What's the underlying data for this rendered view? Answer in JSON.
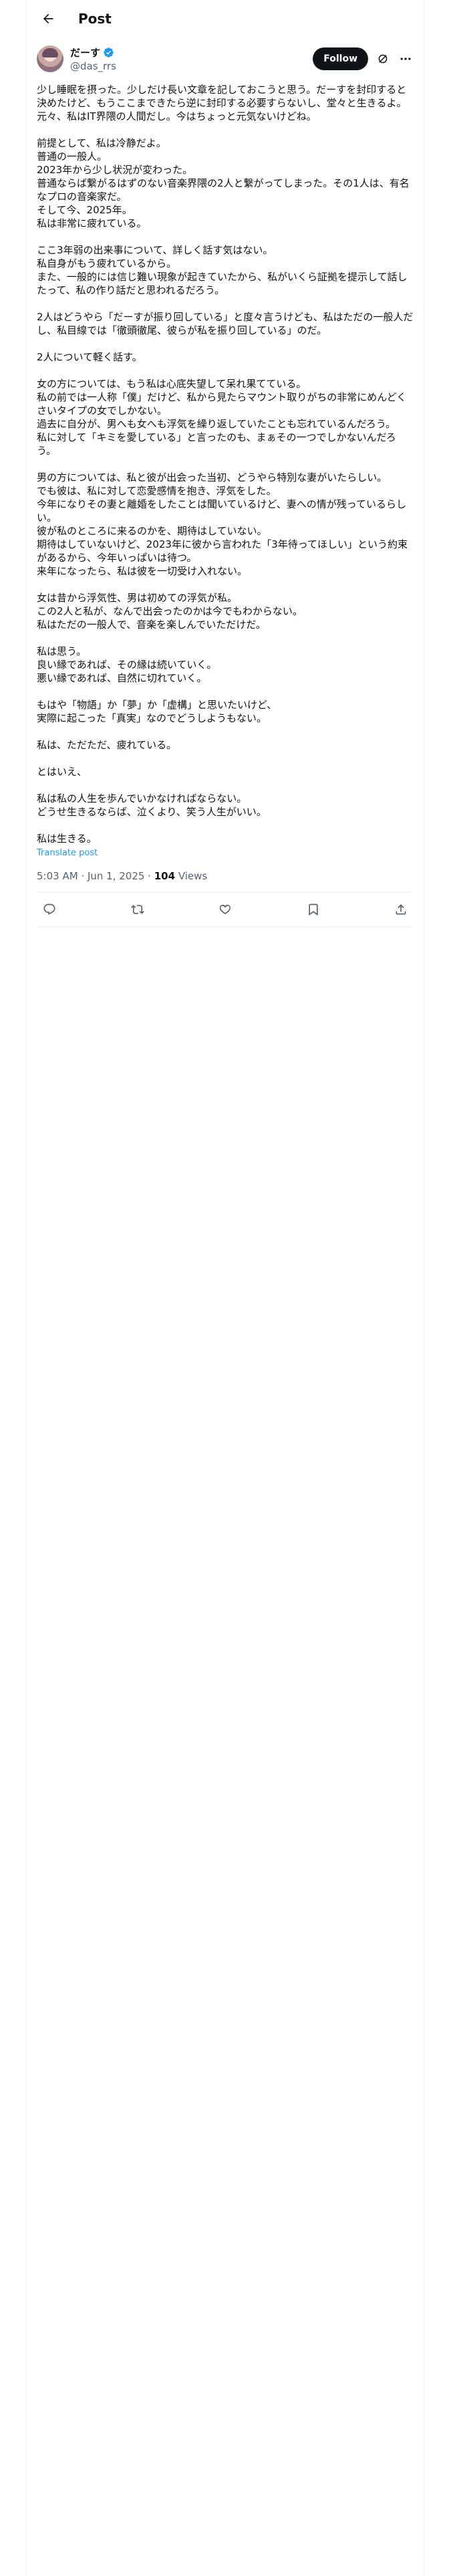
{
  "header": {
    "title": "Post",
    "back_icon": "arrow-left-icon"
  },
  "author": {
    "display_name": "だーす",
    "handle": "@das_rrs",
    "verified": true,
    "follow_label": "Follow",
    "accent": "#1d9bf0"
  },
  "post": {
    "text": "少し睡眠を摂った。少しだけ長い文章を記しておこうと思う。だーすを封印すると決めたけど、もうここまできたら逆に封印する必要すらないし、堂々と生きるよ。元々、私はIT界隈の人間だし。今はちょっと元気ないけどね。\n\n前提として、私は冷静だよ。\n普通の一般人。\n2023年から少し状況が変わった。\n普通ならば繋がるはずのない音楽界隈の2人と繋がってしまった。その1人は、有名なプロの音楽家だ。\nそして今、2025年。\n私は非常に疲れている。\n\nここ3年弱の出来事について、詳しく話す気はない。\n私自身がもう疲れているから。\nまた、一般的には信じ難い現象が起きていたから、私がいくら証拠を提示して話したって、私の作り話だと思われるだろう。\n\n2人はどうやら「だーすが振り回している」と度々言うけども、私はただの一般人だし、私目線では「徹頭徹尾、彼らが私を振り回している」のだ。\n\n2人について軽く話す。\n\n女の方については、もう私は心底失望して呆れ果てている。\n私の前では一人称「僕」だけど、私から見たらマウント取りがちの非常にめんどくさいタイプの女でしかない。\n過去に自分が、男へも女へも浮気を繰り返していたことも忘れているんだろう。\n私に対して「キミを愛している」と言ったのも、まぁその一つでしかないんだろう。\n\n男の方については、私と彼が出会った当初、どうやら特別な妻がいたらしい。\nでも彼は、私に対して恋愛感情を抱き、浮気をした。\n今年になりその妻と離婚をしたことは聞いているけど、妻への情が残っているらしい。\n彼が私のところに来るのかを、期待はしていない。\n期待はしていないけど、2023年に彼から言われた「3年待ってほしい」という約束があるから、今年いっぱいは待つ。\n来年になったら、私は彼を一切受け入れない。\n\n女は昔から浮気性、男は初めての浮気が私。\nこの2人と私が、なんで出会ったのかは今でもわからない。\n私はただの一般人で、音楽を楽しんでいただけだ。\n\n私は思う。\n良い縁であれば、その縁は続いていく。\n悪い縁であれば、自然に切れていく。\n\nもはや「物語」か「夢」か「虚構」と思いたいけど、\n実際に起こった「真実」なのでどうしようもない。\n\n私は、ただただ、疲れている。\n\nとはいえ、\n\n私は私の人生を歩んでいかなければならない。\nどうせ生きるならば、泣くより、笑う人生がいい。\n\n私は生きる。",
    "translate_label": "Translate post",
    "timestamp": "5:03 AM · Jun 1, 2025 · ",
    "views_count": "104",
    "views_label": " Views"
  },
  "actions": {
    "reply_icon": "reply-icon",
    "repost_icon": "repost-icon",
    "like_icon": "heart-icon",
    "bookmark_icon": "bookmark-icon",
    "share_icon": "share-icon"
  }
}
